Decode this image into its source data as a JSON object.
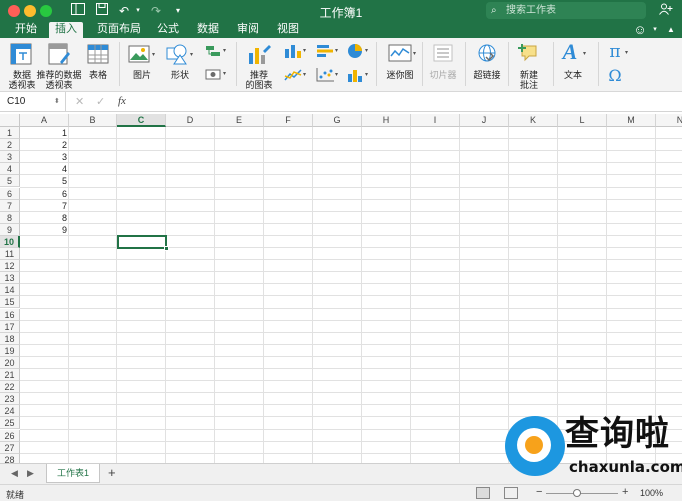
{
  "window": {
    "title": "工作簿1",
    "search_placeholder": "搜索工作表"
  },
  "ribbon_tabs": [
    "开始",
    "插入",
    "页面布局",
    "公式",
    "数据",
    "审阅",
    "视图"
  ],
  "ribbon_active_tab": "插入",
  "ribbon": {
    "pivot_table": "数据\n透视表",
    "recommended_pivot": "推荐的数据\n透视表",
    "table": "表格",
    "picture": "图片",
    "shapes": "形状",
    "recommended_charts": "推荐\n的图表",
    "sparklines": "迷你图",
    "slicer": "切片器",
    "hyperlink": "超链接",
    "new_comment": "新建\n批注",
    "text": "文本",
    "pi": "π",
    "omega": "Ω"
  },
  "formula_bar": {
    "name_box": "C10",
    "fx": "fx",
    "value": ""
  },
  "grid": {
    "columns": [
      "A",
      "B",
      "C",
      "D",
      "E",
      "F",
      "G",
      "H",
      "I",
      "J",
      "K",
      "L",
      "M",
      "N"
    ],
    "selected_column": "C",
    "row_labels": [
      "1",
      "2",
      "3",
      "4",
      "5",
      "6",
      "7",
      "8",
      "9",
      "10",
      "11",
      "12",
      "13",
      "14",
      "15",
      "16",
      "17",
      "18",
      "19",
      "20",
      "21",
      "22",
      "23",
      "24",
      "25",
      "26",
      "27",
      "28"
    ],
    "selected_row": "10",
    "column_a_values": [
      "1",
      "2",
      "3",
      "4",
      "5",
      "6",
      "7",
      "8",
      "9"
    ],
    "active_cell": "C10"
  },
  "sheet_tabs": [
    "工作表1"
  ],
  "status": {
    "text": "就绪",
    "zoom": "100%",
    "zoom_minus": "−",
    "zoom_plus": "+"
  },
  "watermark": {
    "cn": "查询啦",
    "en": "chaxunla.com"
  },
  "colors": {
    "brand_green": "#217346",
    "watermark_blue": "#1d97e0",
    "watermark_orange": "#f7a21b"
  }
}
